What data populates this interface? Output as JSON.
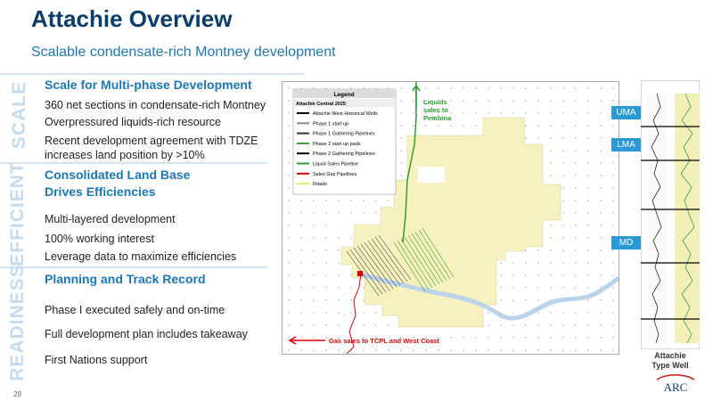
{
  "title": "Attachie Overview",
  "subtitle": "Scalable condensate-rich Montney development",
  "sections": [
    {
      "side_label": "SCALE",
      "heading": "Scale for Multi-phase Development",
      "bullets": [
        "360 net sections in condensate-rich Montney",
        "Overpressured liquids-rich resource",
        "Recent development agreement with TDZE increases land position by >10%"
      ]
    },
    {
      "side_label": "EFFICIENT",
      "heading": "Consolidated Land Base Drives Efficiencies",
      "bullets": [
        "Multi-layered development",
        "100% working interest",
        "Leverage data to maximize efficiencies"
      ]
    },
    {
      "side_label": "READINESS",
      "heading": "Planning and Track Record",
      "bullets": [
        "Phase I executed safely and on-time",
        "Full development plan includes takeaway",
        "First Nations support"
      ]
    }
  ],
  "map": {
    "legend_title": "Legend",
    "legend_subtitle": "Attachie Central 2025",
    "legend_items": [
      {
        "label": "Attachie West Historical Wells",
        "color": "#000000"
      },
      {
        "label": "Phase 1 start up",
        "color": "#8a8a8a"
      },
      {
        "label": "Phase 1 Gathering Pipelines",
        "color": "#333333"
      },
      {
        "label": "Phase 2 start up pads",
        "color": "#2e9e2e"
      },
      {
        "label": "Phase 2 Gathering Pipelines",
        "color": "#000000"
      },
      {
        "label": "Liquid Sales Pipeline",
        "color": "#2e9e2e"
      },
      {
        "label": "Sales Gas Pipelines",
        "color": "#e00000"
      },
      {
        "label": "Roads",
        "color": "#f2e36b"
      }
    ],
    "liquids_label_line1": "Liquids",
    "liquids_label_line2": "sales to",
    "liquids_label_line3": "Pembina",
    "gas_label": "Gas sales to TCPL and West Coast"
  },
  "zones": [
    "UMA",
    "LMA",
    "MD"
  ],
  "type_well_line1": "Attachie",
  "type_well_line2": "Type Well",
  "logo_text": "ARC",
  "page_number": "29",
  "colors": {
    "title": "#0b3d6b",
    "accent": "#1b78b8",
    "side_label": "#c5dbef",
    "tag": "#2a9ad6",
    "gas": "#e00000",
    "liquids": "#2e9e2e"
  }
}
